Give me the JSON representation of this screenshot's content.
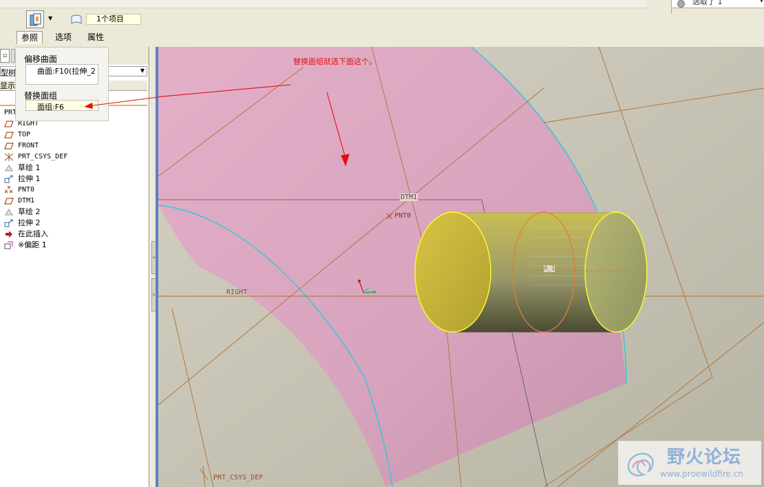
{
  "header": {
    "selection_text": "选取了 1",
    "collector_text": "1个项目",
    "tabs": [
      {
        "label": "参照"
      },
      {
        "label": "选项"
      },
      {
        "label": "属性"
      }
    ]
  },
  "references": {
    "offset_surface_label": "偏移曲面",
    "offset_surface_value": "曲面:F10(拉伸_2",
    "replace_quilt_label": "替换面组",
    "replace_quilt_value": "面组:F6"
  },
  "model_tree": {
    "view_dropdown": "型树",
    "show_button": "显示",
    "root": "PRT",
    "items": [
      {
        "label": "RIGHT",
        "icon": "datum-plane-icon"
      },
      {
        "label": "TOP",
        "icon": "datum-plane-icon"
      },
      {
        "label": "FRONT",
        "icon": "datum-plane-icon"
      },
      {
        "label": "PRT_CSYS_DEF",
        "icon": "csys-icon"
      },
      {
        "label": "草绘 1",
        "icon": "sketch-icon"
      },
      {
        "label": "拉伸 1",
        "icon": "extrude-icon"
      },
      {
        "label": "PNT0",
        "icon": "datum-point-icon"
      },
      {
        "label": "DTM1",
        "icon": "datum-plane-icon"
      },
      {
        "label": "草绘 2",
        "icon": "sketch-icon"
      },
      {
        "label": "拉伸 2",
        "icon": "extrude-icon"
      },
      {
        "label": "在此插入",
        "icon": "insert-here-icon"
      },
      {
        "label": "※偏距 1",
        "icon": "offset-icon"
      }
    ]
  },
  "viewport": {
    "annotation": "替换面组就选下面这个。",
    "labels": {
      "dtm1": "DTM1",
      "pnt0": "PNT0",
      "axis": "A_1",
      "right": "RIGHT",
      "csys": "PRT_CSYS_DEF"
    }
  },
  "watermark": {
    "name": "野火论坛",
    "url": "www.proewildfire.cn"
  },
  "colors": {
    "surface": "#dba7c0",
    "cylinder": "#b9b045",
    "annotation": "#e01010",
    "datum": "#b07030",
    "highlight_edge": "#00c8d8"
  }
}
